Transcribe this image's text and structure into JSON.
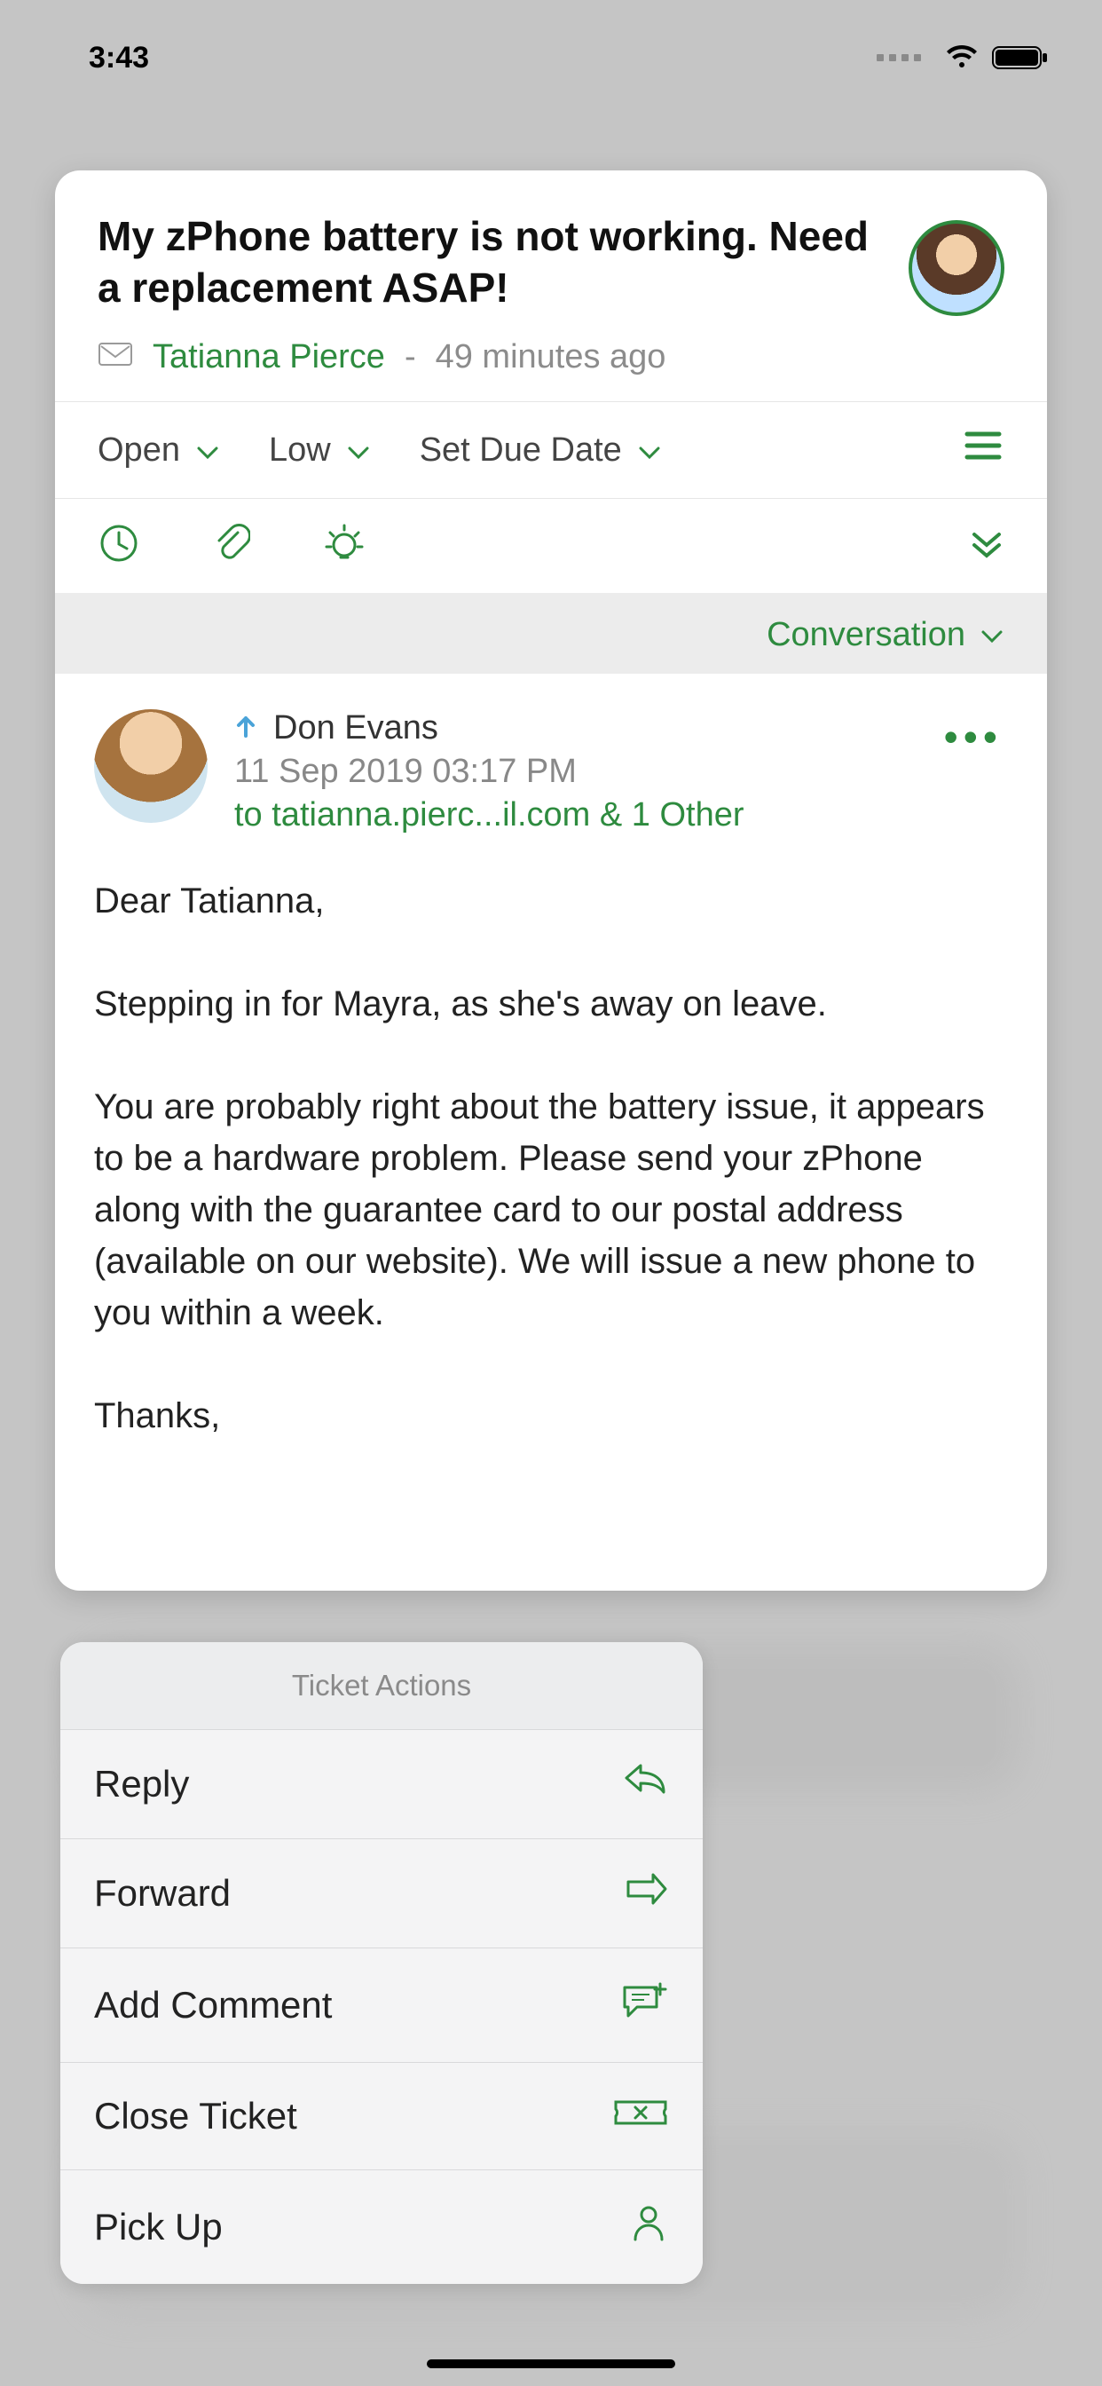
{
  "status": {
    "time": "3:43"
  },
  "ticket": {
    "title": "My zPhone battery is not working. Need a replacement ASAP!",
    "sender": "Tatianna Pierce",
    "age": "49 minutes ago",
    "status": "Open",
    "priority": "Low",
    "due": "Set Due Date"
  },
  "section_label": "Conversation",
  "message": {
    "author": "Don Evans",
    "timestamp": "11 Sep 2019 03:17 PM",
    "to_line": "to tatianna.pierc...il.com  & 1 Other",
    "body": "Dear Tatianna,\n\nStepping in for Mayra, as she's away on leave.\n\nYou are probably right about the battery issue, it appears to be a hardware problem. Please send your zPhone along with the guarantee card to our postal address (available on our website). We will issue a new phone to you within a week.\n\nThanks,"
  },
  "actions": {
    "title": "Ticket Actions",
    "reply": "Reply",
    "forward": "Forward",
    "add_comment": "Add Comment",
    "close_ticket": "Close Ticket",
    "pick_up": "Pick Up"
  }
}
